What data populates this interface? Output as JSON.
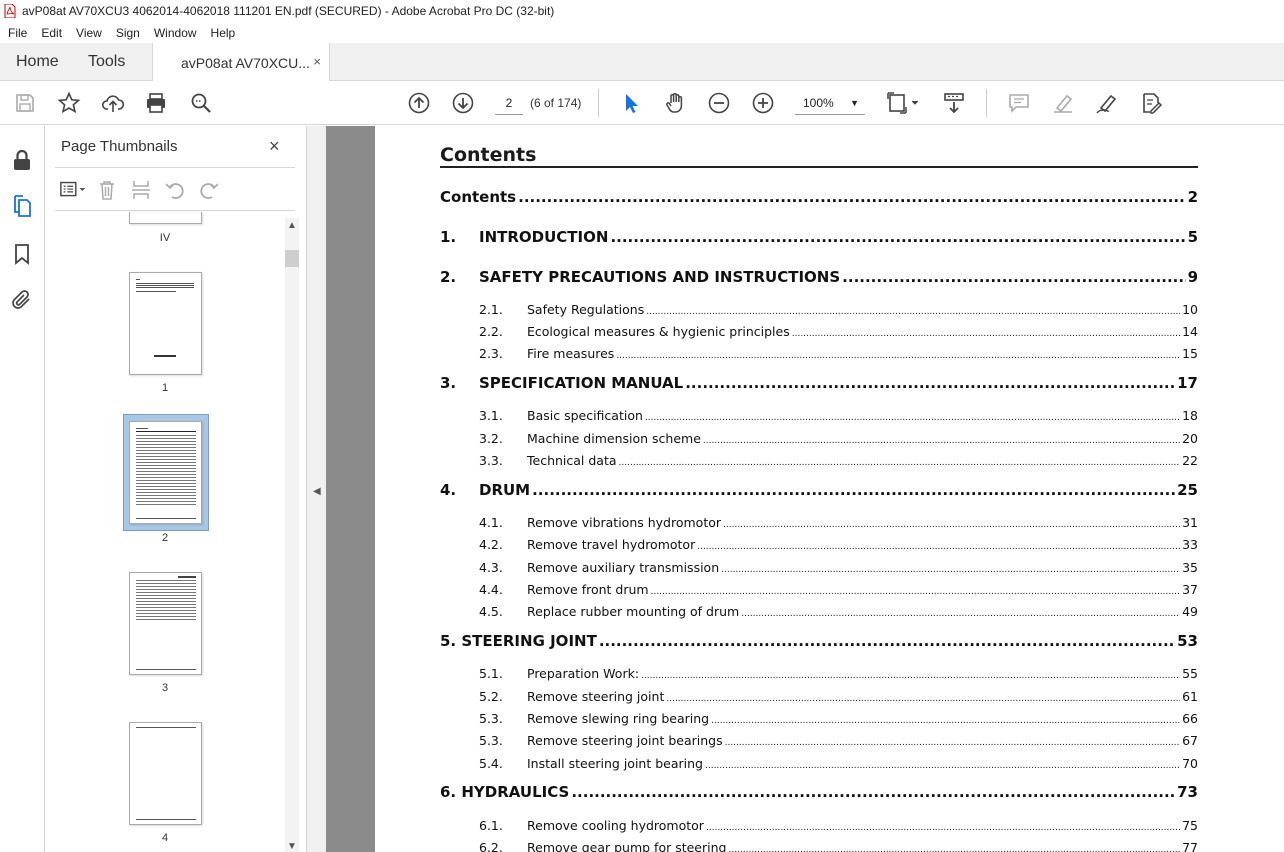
{
  "window": {
    "title": "avP08at AV70XCU3 4062014-4062018 111201 EN.pdf (SECURED) - Adobe Acrobat Pro DC (32-bit)"
  },
  "menu": [
    "File",
    "Edit",
    "View",
    "Sign",
    "Window",
    "Help"
  ],
  "tabs": {
    "home": "Home",
    "tools": "Tools",
    "doc": "avP08at AV70XCU...",
    "close": "×"
  },
  "toolbar": {
    "page_input": "2",
    "page_count": "(6 of 174)",
    "zoom": "100%"
  },
  "thumbnails": {
    "title": "Page Thumbnails",
    "close": "×",
    "labels": [
      "IV",
      "1",
      "2",
      "3",
      "4"
    ]
  },
  "document": {
    "heading": "Contents",
    "toc": [
      {
        "level": 1,
        "num": "",
        "text": "Contents",
        "page": "2"
      },
      {
        "level": 1,
        "num": "1.",
        "text": "INTRODUCTION",
        "page": "5"
      },
      {
        "level": 1,
        "num": "2.",
        "text": "SAFETY PRECAUTIONS AND INSTRUCTIONS",
        "page": "9"
      },
      {
        "level": 2,
        "num": "2.1.",
        "text": "Safety Regulations",
        "page": "10"
      },
      {
        "level": 2,
        "num": "2.2.",
        "text": "Ecological measures & hygienic principles",
        "page": "14"
      },
      {
        "level": 2,
        "num": "2.3.",
        "text": "Fire measures",
        "page": "15"
      },
      {
        "level": 1,
        "num": "3.",
        "text": "SPECIFICATION MANUAL",
        "page": "17"
      },
      {
        "level": 2,
        "num": "3.1.",
        "text": "Basic specification",
        "page": "18"
      },
      {
        "level": 2,
        "num": "3.2.",
        "text": "Machine dimension scheme",
        "page": "20"
      },
      {
        "level": 2,
        "num": "3.3.",
        "text": "Technical data",
        "page": "22"
      },
      {
        "level": 1,
        "num": "4.",
        "text": "DRUM",
        "page": "25"
      },
      {
        "level": 2,
        "num": "4.1.",
        "text": "Remove vibrations hydromotor",
        "page": "31"
      },
      {
        "level": 2,
        "num": "4.2.",
        "text": "Remove travel hydromotor",
        "page": "33"
      },
      {
        "level": 2,
        "num": "4.3.",
        "text": "Remove auxiliary transmission",
        "page": "35"
      },
      {
        "level": 2,
        "num": "4.4.",
        "text": "Remove front drum",
        "page": "37"
      },
      {
        "level": 2,
        "num": "4.5.",
        "text": "Replace rubber mounting of drum",
        "page": "49"
      },
      {
        "level": 1,
        "num": "",
        "text": "5. STEERING JOINT",
        "page": "53"
      },
      {
        "level": 2,
        "num": "5.1.",
        "text": "Preparation Work:",
        "page": "55"
      },
      {
        "level": 2,
        "num": "5.2.",
        "text": "Remove steering joint",
        "page": "61"
      },
      {
        "level": 2,
        "num": "5.3.",
        "text": "Remove slewing ring bearing",
        "page": "66"
      },
      {
        "level": 2,
        "num": "5.3.",
        "text": "Remove steering joint bearings",
        "page": "67"
      },
      {
        "level": 2,
        "num": "5.4.",
        "text": "Install steering joint bearing",
        "page": "70"
      },
      {
        "level": 1,
        "num": "",
        "text": "6. HYDRAULICS",
        "page": "73"
      },
      {
        "level": 2,
        "num": "6.1.",
        "text": "Remove cooling hydromotor",
        "page": "75"
      },
      {
        "level": 2,
        "num": "6.2.",
        "text": "Remove gear pump for steering",
        "page": "77"
      }
    ]
  }
}
